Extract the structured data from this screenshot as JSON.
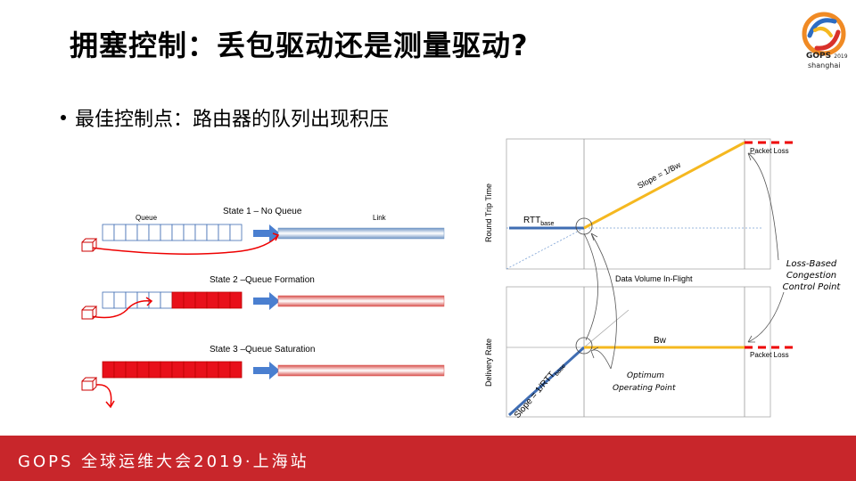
{
  "slide": {
    "title": "拥塞控制：丢包驱动还是测量驱动?",
    "bullet": "最佳控制点：路由器的队列出现积压"
  },
  "logo": {
    "brand": "GOPS",
    "year": "2019",
    "city": "shanghai"
  },
  "queue_diagram": {
    "states": [
      {
        "title": "State 1 – No Queue",
        "queue_label": "Queue",
        "link_label": "Link",
        "filled_cells": 0
      },
      {
        "title": "State 2 –Queue Formation",
        "filled_cells": 6
      },
      {
        "title": "State 3 –Queue Saturation",
        "filled_cells": 12
      }
    ],
    "queue_cells": 12
  },
  "graphs": {
    "top": {
      "ylabel": "Round Trip Time",
      "xlabel": "Data Volume In-Flight",
      "rtt_label": "RTT",
      "rtt_sub": "base",
      "slope_label": "Slope = 1/Bw",
      "loss_label": "Packet Loss"
    },
    "bottom": {
      "ylabel": "Delivery Rate",
      "bw_label": "Bw",
      "slope_label": "Slope = 1/RTT",
      "slope_sub": "base",
      "loss_label": "Packet Loss"
    },
    "annotations": {
      "loss_based": [
        "Loss-Based",
        "Congestion",
        "Control Point"
      ],
      "optimum": [
        "Optimum",
        "Operating Point"
      ]
    }
  },
  "footer": {
    "text": "GOPS 全球运维大会2019·上海站"
  },
  "colors": {
    "footer_bg": "#c8262b",
    "queue_red": "#e8101a",
    "line_blue": "#3f6db3",
    "line_yellow": "#f5b820",
    "arrow_blue": "#4a7fd0"
  }
}
